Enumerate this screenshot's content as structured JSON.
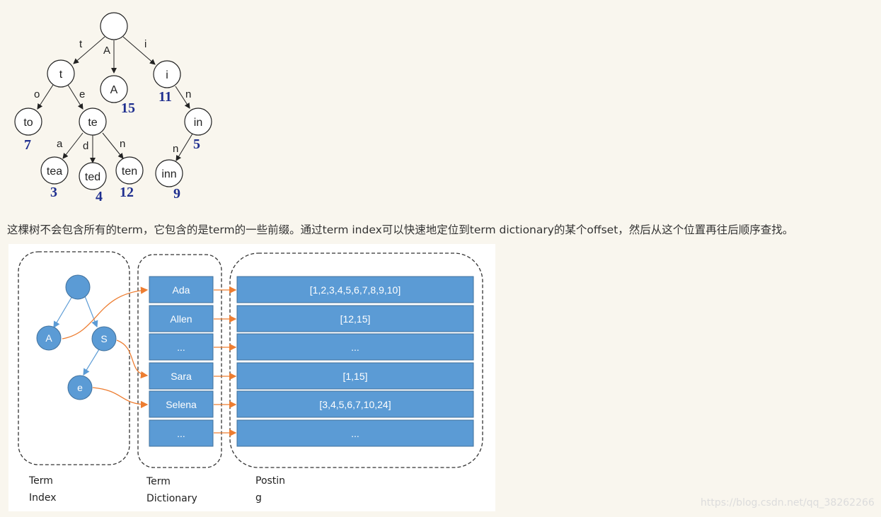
{
  "trie": {
    "edge_labels": [
      "t",
      "A",
      "i",
      "o",
      "e",
      "n",
      "a",
      "d",
      "n",
      "n"
    ],
    "nodes": [
      {
        "label": "",
        "count": ""
      },
      {
        "label": "t",
        "count": ""
      },
      {
        "label": "A",
        "count": "15"
      },
      {
        "label": "i",
        "count": "11"
      },
      {
        "label": "to",
        "count": "7"
      },
      {
        "label": "te",
        "count": ""
      },
      {
        "label": "in",
        "count": "5"
      },
      {
        "label": "tea",
        "count": "3"
      },
      {
        "label": "ted",
        "count": "4"
      },
      {
        "label": "ten",
        "count": "12"
      },
      {
        "label": "inn",
        "count": "9"
      }
    ]
  },
  "caption": "这棵树不会包含所有的term，它包含的是term的一些前缀。通过term index可以快速地定位到term dictionary的某个offset，然后从这个位置再往后顺序查找。",
  "term_index": {
    "nodes": [
      "",
      "A",
      "S",
      "e"
    ],
    "label_lines": [
      "Term",
      "Index"
    ]
  },
  "term_dictionary": {
    "rows": [
      "Ada",
      "Allen",
      "...",
      "Sara",
      "Selena",
      "..."
    ],
    "label_lines": [
      "Term",
      "Dictionary"
    ]
  },
  "postings": {
    "rows": [
      "[1,2,3,4,5,6,7,8,9,10]",
      "[12,15]",
      "...",
      "[1,15]",
      "[3,4,5,6,7,10,24]",
      "..."
    ],
    "label_lines": [
      "Postin",
      "g"
    ]
  },
  "watermark": "https://blog.csdn.net/qq_38262266",
  "colors": {
    "box_fill": "#5b9bd5",
    "box_stroke": "#41719c",
    "arrow_orange": "#ed7d31",
    "arrow_blue": "#5b9bd5",
    "count_blue": "#1f2f8f"
  }
}
